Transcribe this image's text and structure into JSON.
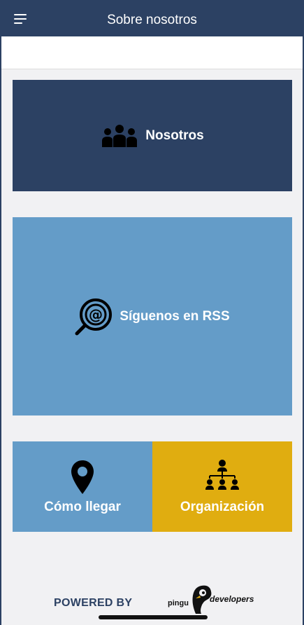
{
  "header": {
    "title": "Sobre nosotros",
    "menu_icon": "hamburger-menu-icon"
  },
  "tiles": {
    "nosotros": {
      "label": "Nosotros",
      "icon": "group-people-icon",
      "color": "#2c4163"
    },
    "rss": {
      "label": "Síguenos en RSS",
      "icon": "at-search-icon",
      "color": "#649cc8"
    },
    "como_llegar": {
      "label": "Cómo llegar",
      "icon": "map-pin-icon",
      "color": "#649cc8"
    },
    "organizacion": {
      "label": "Organización",
      "icon": "org-chart-icon",
      "color": "#e0ad10"
    }
  },
  "footer": {
    "powered_by": "POWERED BY",
    "logo_text_left": "pingu",
    "logo_text_right": "developers"
  },
  "colors": {
    "header_bg": "#2c4163",
    "background": "#f1f1f3"
  }
}
